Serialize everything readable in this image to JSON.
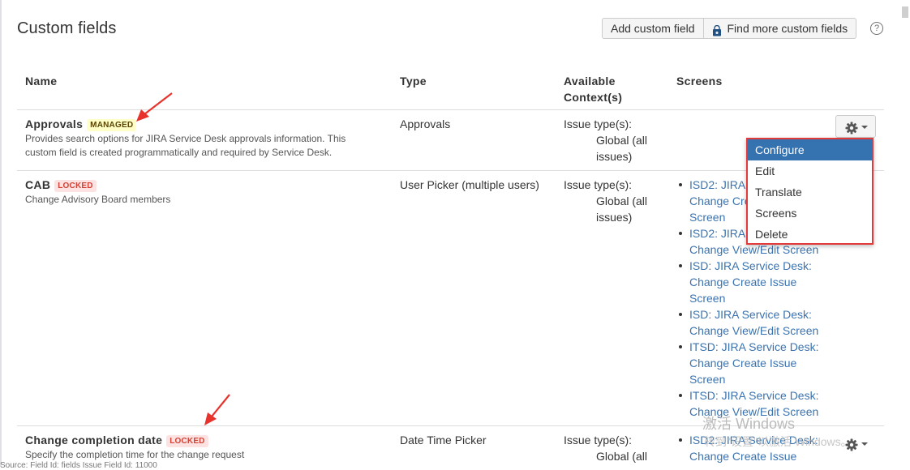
{
  "page": {
    "title": "Custom fields"
  },
  "toolbar": {
    "add_label": "Add custom field",
    "find_label": "Find more custom fields",
    "help_glyph": "?"
  },
  "table": {
    "headers": {
      "name": "Name",
      "type": "Type",
      "context": "Available Context(s)",
      "screens": "Screens"
    },
    "rows": [
      {
        "name": "Approvals",
        "badge": "MANAGED",
        "description": "Provides search options for JIRA Service Desk approvals information. This custom field is created programmatically and required by Service Desk.",
        "type": "Approvals",
        "context_label": "Issue type(s):",
        "context_value": "Global (all issues)",
        "screens": []
      },
      {
        "name": "CAB",
        "badge": "LOCKED",
        "description": "Change Advisory Board members",
        "type": "User Picker (multiple users)",
        "context_label": "Issue type(s):",
        "context_value": "Global (all issues)",
        "screens": [
          "ISD2: JIRA Service Desk: Change Create Issue Screen",
          "ISD2: JIRA Service Desk: Change View/Edit Screen",
          "ISD: JIRA Service Desk: Change Create Issue Screen",
          "ISD: JIRA Service Desk: Change View/Edit Screen",
          "ITSD: JIRA Service Desk: Change Create Issue Screen",
          "ITSD: JIRA Service Desk: Change View/Edit Screen"
        ]
      },
      {
        "name": "Change completion date",
        "badge": "LOCKED",
        "description": "Specify the completion time for the change request",
        "type": "Date Time Picker",
        "context_label": "Issue type(s):",
        "context_value": "Global (all",
        "screens": [
          "ISD2: JIRA Service Desk: Change Create Issue"
        ]
      }
    ]
  },
  "dropdown": {
    "items": [
      "Configure",
      "Edit",
      "Translate",
      "Screens",
      "Delete"
    ],
    "active": "Configure"
  },
  "overlay": {
    "watermark": "激活 Windows",
    "watermark_sub": "转到\"设置\"以激活 Windows。",
    "status_text": "Source: Field Id: fields Issue Field Id: 11000"
  },
  "colors": {
    "link": "#3b73af",
    "highlight": "#e03a3a",
    "menu_active": "#3572b0"
  }
}
